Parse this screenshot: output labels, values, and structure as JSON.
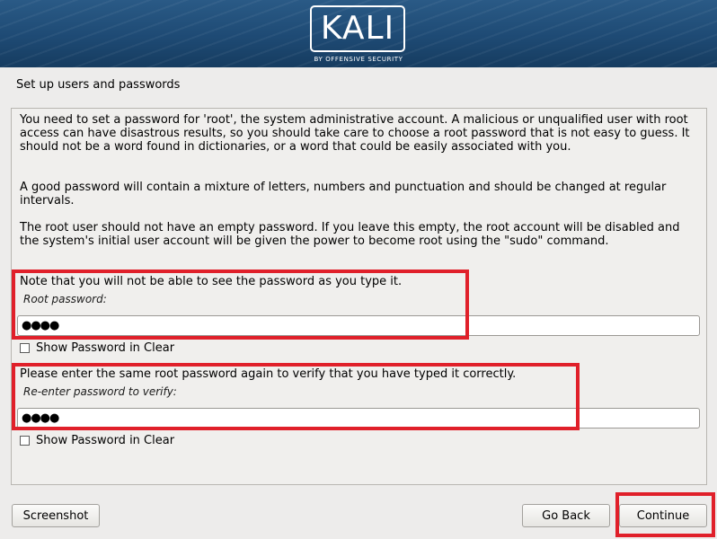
{
  "header": {
    "logo_text": "KALI",
    "logo_subtitle": "BY OFFENSIVE SECURITY"
  },
  "page": {
    "title": "Set up users and passwords"
  },
  "content": {
    "paragraph1": "You need to set a password for 'root', the system administrative account. A malicious or unqualified user with root access can have disastrous results, so you should take care to choose a root password that is not easy to guess. It should not be a word found in dictionaries, or a word that could be easily associated with you.",
    "paragraph2": "A good password will contain a mixture of letters, numbers and punctuation and should be changed at regular intervals.",
    "paragraph3": "The root user should not have an empty password. If you leave this empty, the root account will be disabled and the system's initial user account will be given the power to become root using the \"sudo\" command.",
    "note1": "Note that you will not be able to see the password as you type it.",
    "root_password_label": "Root password:",
    "root_password_value": "●●●●",
    "show_password_label_1": "Show Password in Clear",
    "note2": "Please enter the same root password again to verify that you have typed it correctly.",
    "verify_password_label": "Re-enter password to verify:",
    "verify_password_value": "●●●●",
    "show_password_label_2": "Show Password in Clear"
  },
  "buttons": {
    "screenshot": "Screenshot",
    "go_back": "Go Back",
    "continue": "Continue"
  },
  "colors": {
    "highlight": "#e0202a",
    "banner": "#1e4a74"
  }
}
